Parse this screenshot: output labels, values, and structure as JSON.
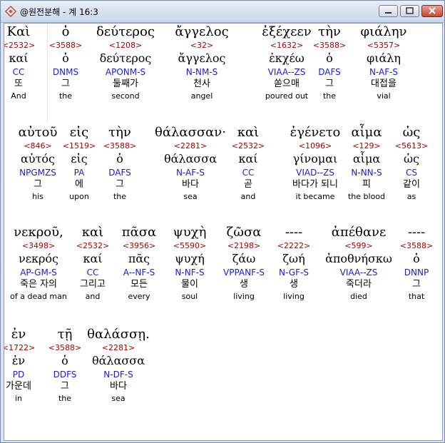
{
  "window": {
    "title": "@원전분해 - 계 16:3"
  },
  "rows": [
    [
      {
        "greek": "Καὶ",
        "strong": "<2532>",
        "lemma": "καί",
        "parse": "CC",
        "korean": "또",
        "english": "And"
      },
      {
        "greek": "ὁ",
        "strong": "<3588>",
        "lemma": "ὁ",
        "parse": "DNMS",
        "korean": "그",
        "english": "the"
      },
      {
        "greek": "δεύτερος",
        "strong": "<1208>",
        "lemma": "δεύτερος",
        "parse": "APONM-S",
        "korean": "둘째가",
        "english": "second"
      },
      {
        "greek": "ἄγγελος",
        "strong": "<32>",
        "lemma": "ἄγγελος",
        "parse": "N-NM-S",
        "korean": "천사",
        "english": "angel"
      },
      {
        "greek": "ἐξέχεεν",
        "strong": "<1632>",
        "lemma": "ἐκχέω",
        "parse": "VIAA--ZS",
        "korean": "쏟으매",
        "english": "poured out"
      },
      {
        "greek": "τὴν",
        "strong": "<3588>",
        "lemma": "ὁ",
        "parse": "DAFS",
        "korean": "그",
        "english": "the"
      },
      {
        "greek": "φιάλην",
        "strong": "<5357>",
        "lemma": "φιάλη",
        "parse": "N-AF-S",
        "korean": "대접을",
        "english": "vial"
      }
    ],
    [
      {
        "greek": "αὐτοῦ",
        "strong": "<846>",
        "lemma": "αὐτός",
        "parse": "NPGMZS",
        "korean": "그",
        "english": "his"
      },
      {
        "greek": "εἰς",
        "strong": "<1519>",
        "lemma": "εἰς",
        "parse": "PA",
        "korean": "에",
        "english": "upon"
      },
      {
        "greek": "τὴν",
        "strong": "<3588>",
        "lemma": "ὁ",
        "parse": "DAFS",
        "korean": "그",
        "english": "the"
      },
      {
        "greek": "θάλασσαν·",
        "strong": "<2281>",
        "lemma": "θάλασσα",
        "parse": "N-AF-S",
        "korean": "바다",
        "english": "sea"
      },
      {
        "greek": "καὶ",
        "strong": "<2532>",
        "lemma": "καί",
        "parse": "CC",
        "korean": "곧",
        "english": "and"
      },
      {
        "greek": "ἐγένετο",
        "strong": "<1096>",
        "lemma": "γίνομαι",
        "parse": "VIAD--ZS",
        "korean": "바다가 되니",
        "english": "it became"
      },
      {
        "greek": "αἷμα",
        "strong": "<129>",
        "lemma": "αἷμα",
        "parse": "N-NN-S",
        "korean": "피",
        "english": "the blood"
      },
      {
        "greek": "ὡς",
        "strong": "<5613>",
        "lemma": "ὡς",
        "parse": "CS",
        "korean": "같이",
        "english": "as"
      }
    ],
    [
      {
        "greek": "νεκροῦ,",
        "strong": "<3498>",
        "lemma": "νεκρός",
        "parse": "AP-GM-S",
        "korean": "죽은 자의",
        "english": "of a dead man"
      },
      {
        "greek": "καὶ",
        "strong": "<2532>",
        "lemma": "καί",
        "parse": "CC",
        "korean": "그리고",
        "english": "and"
      },
      {
        "greek": "πᾶσα",
        "strong": "<3956>",
        "lemma": "πᾶς",
        "parse": "A--NF-S",
        "korean": "모든",
        "english": "every"
      },
      {
        "greek": "ψυχὴ",
        "strong": "<5590>",
        "lemma": "ψυχή",
        "parse": "N-NF-S",
        "korean": "물이",
        "english": "soul"
      },
      {
        "greek": "ζῶσα",
        "strong": "<2198>",
        "lemma": "ζάω",
        "parse": "VPPANF-S",
        "korean": "생",
        "english": "living"
      },
      {
        "greek": "----",
        "strong": "<2222>",
        "lemma": "ζωή",
        "parse": "N-GF-S",
        "korean": "생",
        "english": "living"
      },
      {
        "greek": "ἀπέθανε",
        "strong": "<599>",
        "lemma": "ἀποθνήσκω",
        "parse": "VIAA--ZS",
        "korean": "죽더라",
        "english": "died"
      },
      {
        "greek": "----",
        "strong": "<3588>",
        "lemma": "ὁ",
        "parse": "DNNP",
        "korean": "그",
        "english": "that"
      }
    ],
    [
      {
        "greek": "ἐν",
        "strong": "<1722>",
        "lemma": "ἐν",
        "parse": "PD",
        "korean": "가운데",
        "english": "in"
      },
      {
        "greek": "τῇ",
        "strong": "<3588>",
        "lemma": "ὁ",
        "parse": "DDFS",
        "korean": "그",
        "english": "the"
      },
      {
        "greek": "θαλάσσῃ.",
        "strong": "<2281>",
        "lemma": "θάλασσα",
        "parse": "N-DF-S",
        "korean": "바다",
        "english": "sea"
      }
    ]
  ]
}
